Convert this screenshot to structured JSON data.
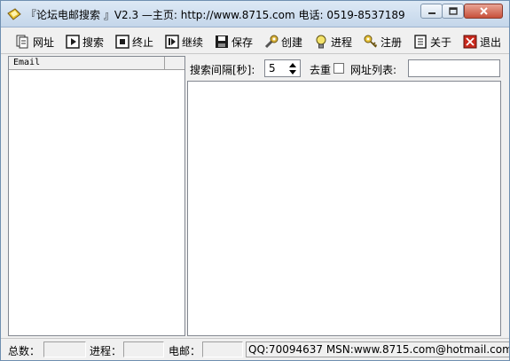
{
  "window": {
    "title": "『论坛电邮搜索 』V2.3   —主页: http://www.8715.com 电话: 0519-8537189"
  },
  "toolbar": {
    "items": [
      {
        "label": "网址",
        "icon": "pages-icon"
      },
      {
        "label": "搜索",
        "icon": "play-icon"
      },
      {
        "label": "终止",
        "icon": "stop-icon"
      },
      {
        "label": "继续",
        "icon": "resume-icon"
      },
      {
        "label": "保存",
        "icon": "floppy-disk-icon"
      },
      {
        "label": "创建",
        "icon": "wrench-icon"
      },
      {
        "label": "进程",
        "icon": "lightbulb-icon"
      },
      {
        "label": "注册",
        "icon": "key-icon"
      },
      {
        "label": "关于",
        "icon": "document-icon"
      },
      {
        "label": "退出",
        "icon": "exit-icon"
      }
    ]
  },
  "email_list": {
    "column_header": "Email"
  },
  "options": {
    "interval_label": "搜索间隔[秒]:",
    "interval_value": "5",
    "dedupe_label": "去重",
    "dedupe_checked": false,
    "url_list_label": "网址列表:",
    "url_list_value": ""
  },
  "statusbar": {
    "total_label": "总数：",
    "progress_label": "进程：",
    "email_label": "电邮：",
    "contact": "QQ:70094637 MSN:www.8715.com@hotmail.com"
  }
}
